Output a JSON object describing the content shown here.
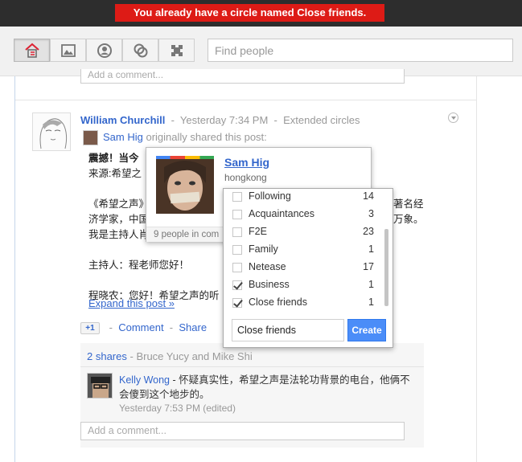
{
  "banner": {
    "message": "You already have a circle named Close friends."
  },
  "nav": {
    "items": [
      {
        "name": "home"
      },
      {
        "name": "photos"
      },
      {
        "name": "profile"
      },
      {
        "name": "circles"
      },
      {
        "name": "games"
      }
    ],
    "search_placeholder": "Find people"
  },
  "top_comment": {
    "placeholder": "Add a comment..."
  },
  "post": {
    "author": "William Churchill",
    "sep1": "-",
    "time": "Yesterday 7:34 PM",
    "sep2": "-",
    "visibility": "Extended circles",
    "shared_by": "Sam Hig",
    "shared_text": "originally shared this post:",
    "body": {
      "line1_left": "震撼！当今",
      "line1_bold": true,
      "line2_left": "来源:希望之",
      "line3_left": "《希望之声》",
      "line3_right": "著名经",
      "line4_left": "济学家，中国",
      "line4_right": "万象。",
      "line5_left": "我是主持人肖",
      "line6": "主持人：程老师您好！",
      "line7": "程晓农：您好！希望之声的听"
    },
    "expand": "Expand this post »",
    "actions": {
      "plusone": "+1",
      "comment": "Comment",
      "share": "Share",
      "sep": "-"
    }
  },
  "shares": {
    "count_text": "2 shares",
    "by": "- Bruce Yucy and Mike Shi"
  },
  "comment": {
    "author": "Kelly Wong",
    "text": "- 怀疑真实性，希望之声是法轮功背景的电台，他俩不会傻到这个地步的。",
    "time": "Yesterday 7:53 PM (edited)"
  },
  "add_comment": {
    "placeholder": "Add a comment..."
  },
  "hovercard": {
    "name": "Sam Hig",
    "location": "hongkong",
    "footer": "9 people in com"
  },
  "circles_menu": {
    "items": [
      {
        "label": "Following",
        "count": "14",
        "checked": false
      },
      {
        "label": "Acquaintances",
        "count": "3",
        "checked": false
      },
      {
        "label": "F2E",
        "count": "23",
        "checked": false
      },
      {
        "label": "Family",
        "count": "1",
        "checked": false
      },
      {
        "label": "Netease",
        "count": "17",
        "checked": false
      },
      {
        "label": "Business",
        "count": "1",
        "checked": true
      },
      {
        "label": "Close friends",
        "count": "1",
        "checked": true
      }
    ],
    "new_circle_value": "Close friends",
    "create_label": "Create"
  }
}
